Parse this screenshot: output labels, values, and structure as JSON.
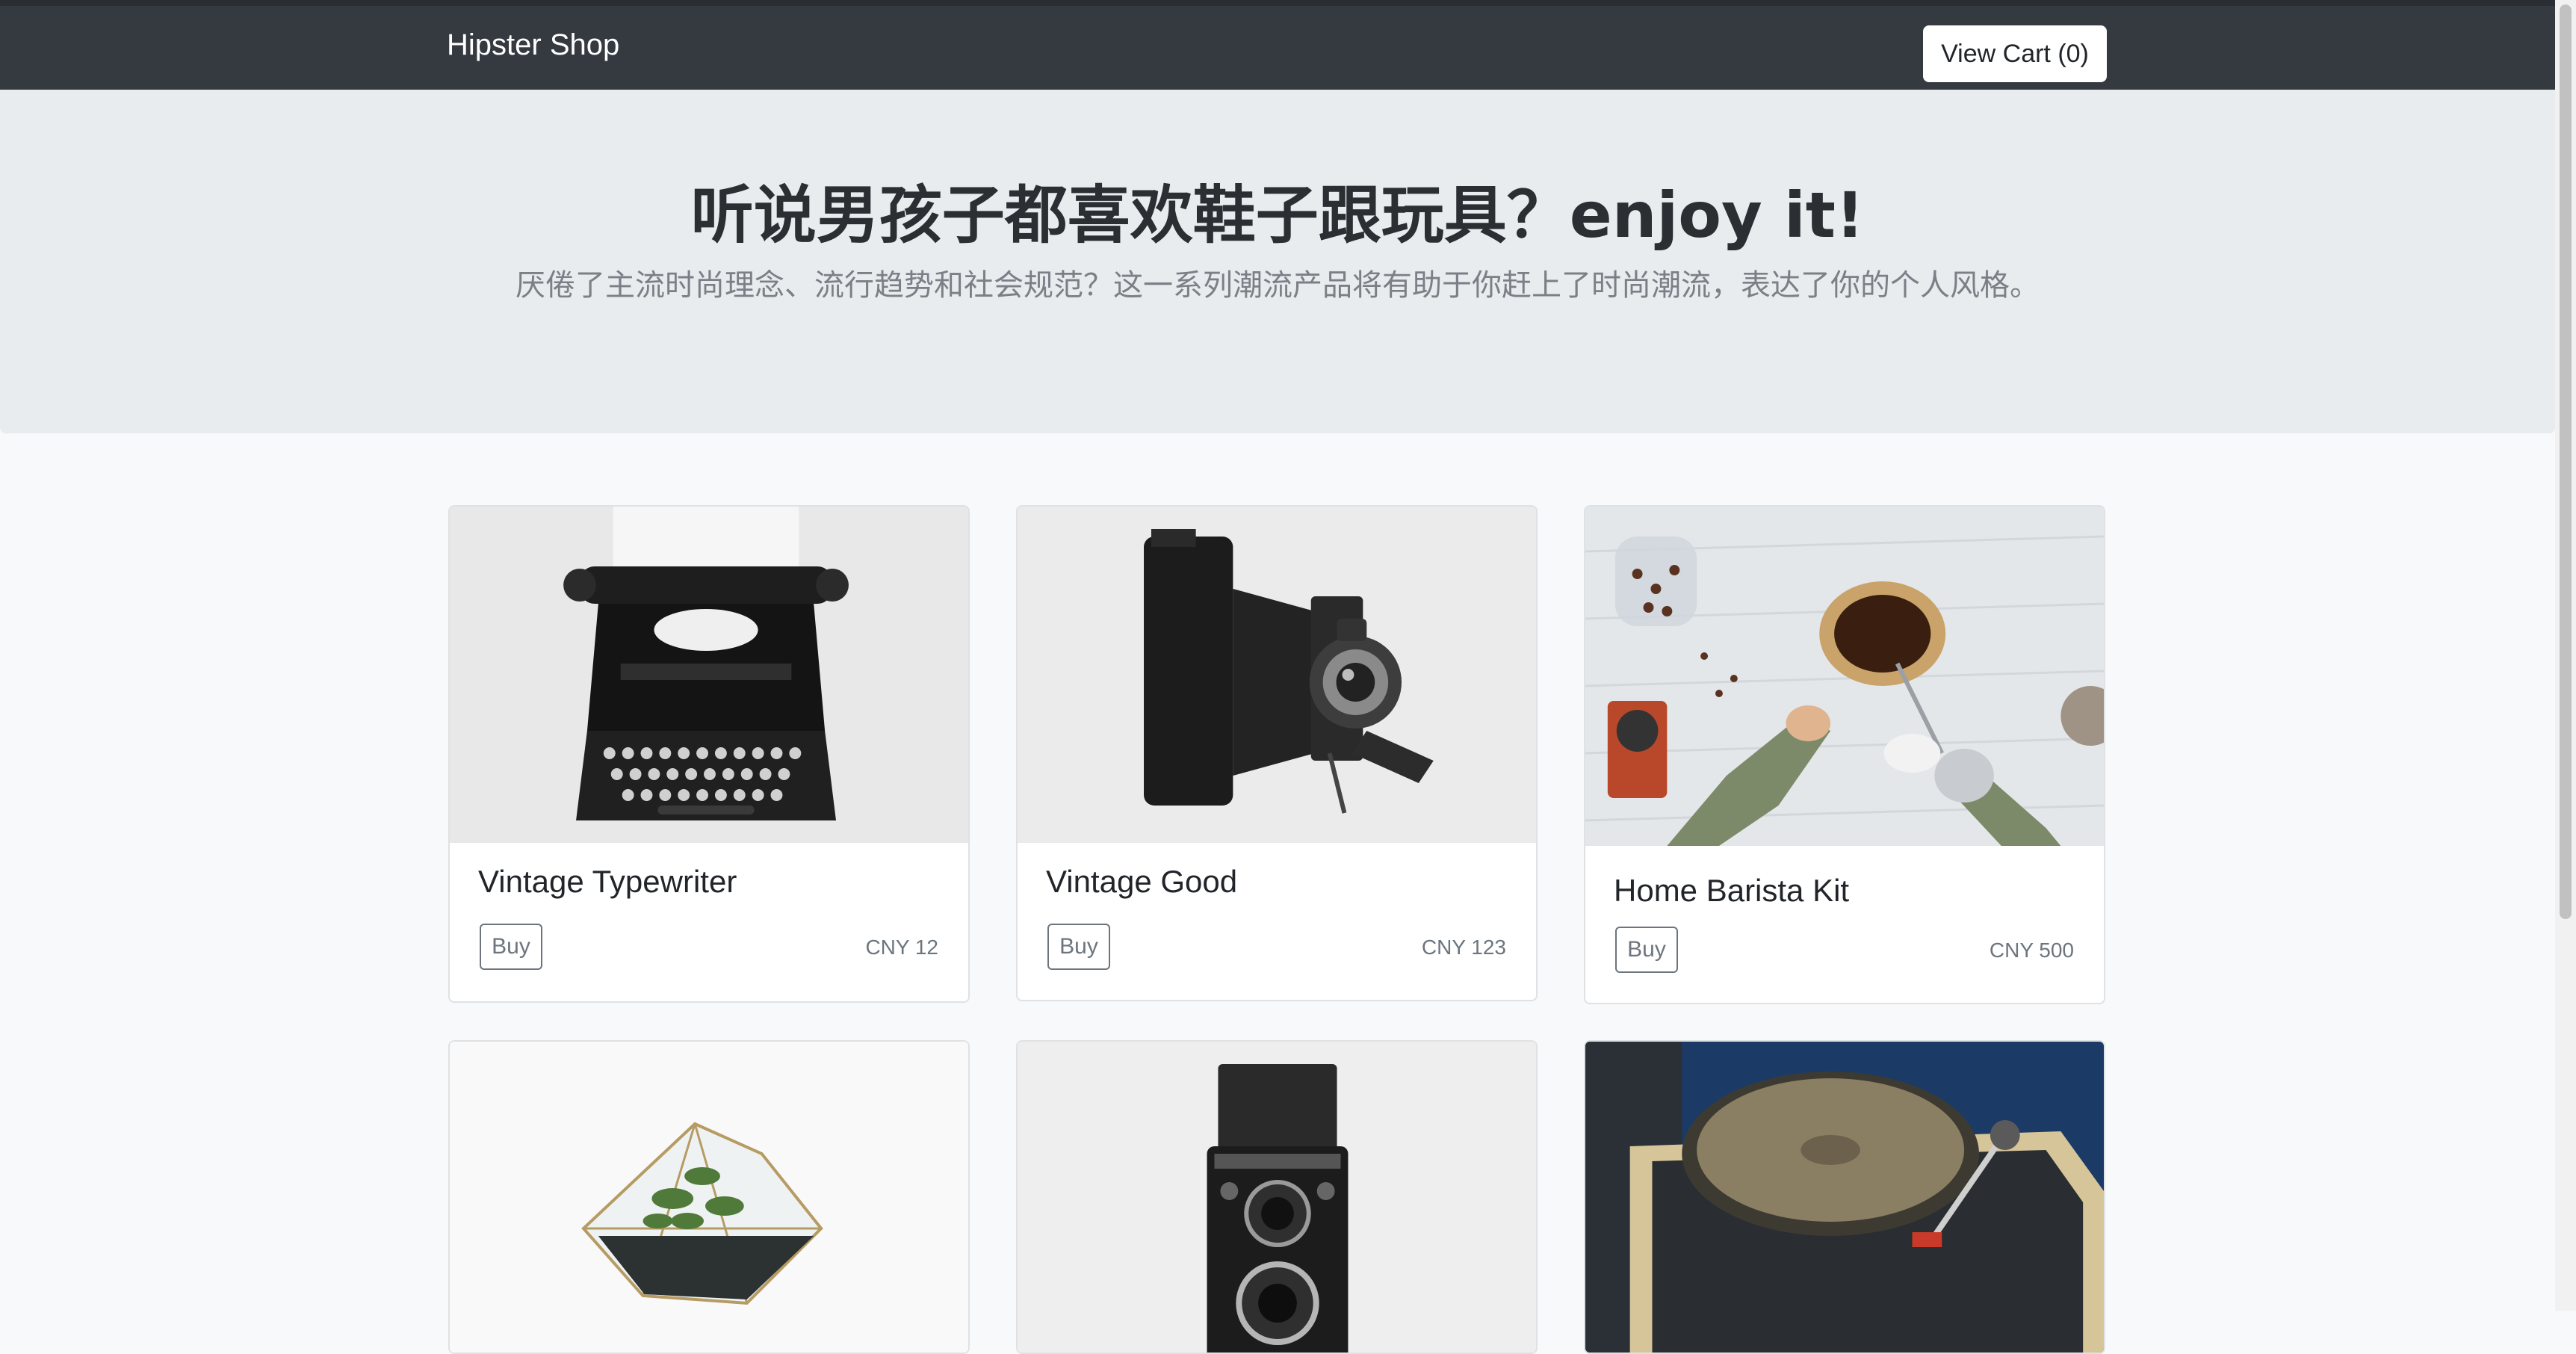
{
  "navbar": {
    "brand": "Hipster Shop",
    "cart_label": "View Cart (0)"
  },
  "hero": {
    "title": "听说男孩子都喜欢鞋子跟玩具？enjoy it!",
    "subtitle": "厌倦了主流时尚理念、流行趋势和社会规范？这一系列潮流产品将有助于你赶上了时尚潮流，表达了你的个人风格。"
  },
  "products": [
    {
      "name": "Vintage Typewriter",
      "buy_label": "Buy",
      "price": "CNY 12",
      "image": "typewriter"
    },
    {
      "name": "Vintage Good",
      "buy_label": "Buy",
      "price": "CNY 123",
      "image": "folding-camera"
    },
    {
      "name": "Home Barista Kit",
      "buy_label": "Buy",
      "price": "CNY 500",
      "image": "coffee-pour-over"
    },
    {
      "name": "",
      "buy_label": "",
      "price": "",
      "image": "terrarium"
    },
    {
      "name": "",
      "buy_label": "",
      "price": "",
      "image": "twin-lens-camera"
    },
    {
      "name": "",
      "buy_label": "",
      "price": "",
      "image": "record-player"
    }
  ]
}
